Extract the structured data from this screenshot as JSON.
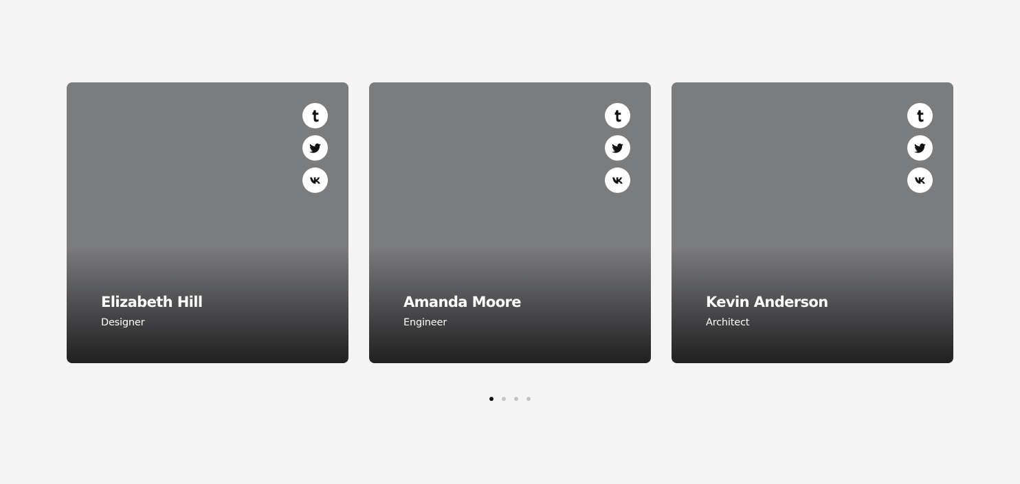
{
  "team": {
    "members": [
      {
        "name": "Elizabeth Hill",
        "role": "Designer",
        "socials": [
          "tumblr-icon",
          "twitter-icon",
          "vk-icon"
        ]
      },
      {
        "name": "Amanda Moore",
        "role": "Engineer",
        "socials": [
          "tumblr-icon",
          "twitter-icon",
          "vk-icon"
        ]
      },
      {
        "name": "Kevin Anderson",
        "role": "Architect",
        "socials": [
          "tumblr-icon",
          "twitter-icon",
          "vk-icon"
        ]
      }
    ]
  },
  "pagination": {
    "pages": 4,
    "active_page": 1
  },
  "colors": {
    "background": "#f4f4f4",
    "card_top": "#7b7c7e",
    "card_bottom": "#202020",
    "dot_active": "#111111",
    "dot_inactive": "#c4c4c4"
  }
}
